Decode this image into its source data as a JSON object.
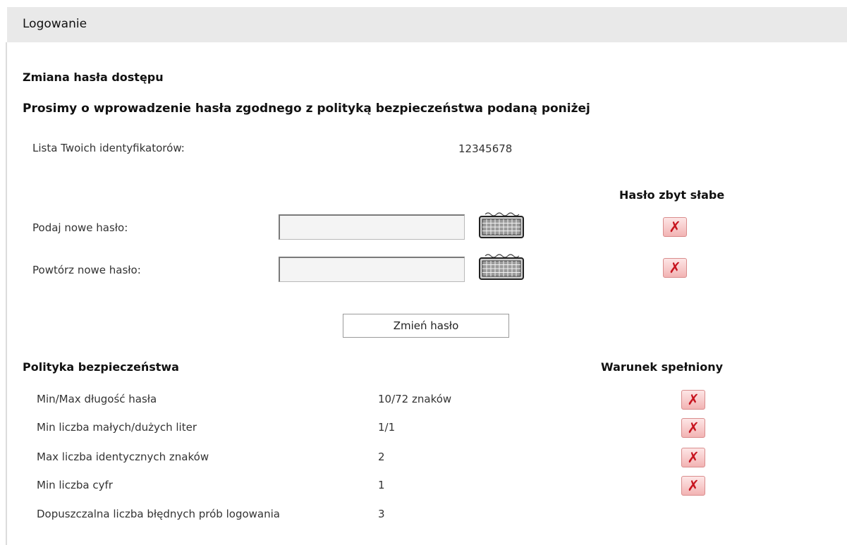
{
  "header": {
    "title": "Logowanie"
  },
  "section_title": "Zmiana hasła dostępu",
  "instruction": "Prosimy o wprowadzenie hasła zgodnego z polityką bezpieczeństwa podaną poniżej",
  "identifiers": {
    "label": "Lista Twoich identyfikatorów:",
    "value": "12345678"
  },
  "strength_header": "Hasło zbyt słabe",
  "fields": {
    "new_password": {
      "label": "Podaj nowe hasło:",
      "value": ""
    },
    "repeat_password": {
      "label": "Powtórz nowe hasło:",
      "value": ""
    }
  },
  "submit_label": "Zmień hasło",
  "policy": {
    "title": "Polityka bezpieczeństwa",
    "status_header": "Warunek spełniony",
    "rules": [
      {
        "label": "Min/Max długość hasła",
        "value": "10/72 znaków",
        "met": false
      },
      {
        "label": "Min liczba małych/dużych liter",
        "value": "1/1",
        "met": false
      },
      {
        "label": "Max liczba identycznych znaków",
        "value": "2",
        "met": false
      },
      {
        "label": "Min liczba cyfr",
        "value": "1",
        "met": false
      },
      {
        "label": "Dopuszczalna liczba błędnych prób logowania",
        "value": "3"
      }
    ]
  },
  "status_icon": "x-icon",
  "colors": {
    "header_bg": "#e9e9e9",
    "x_icon": "#c7141f",
    "x_bg": "#f2b3b3"
  }
}
